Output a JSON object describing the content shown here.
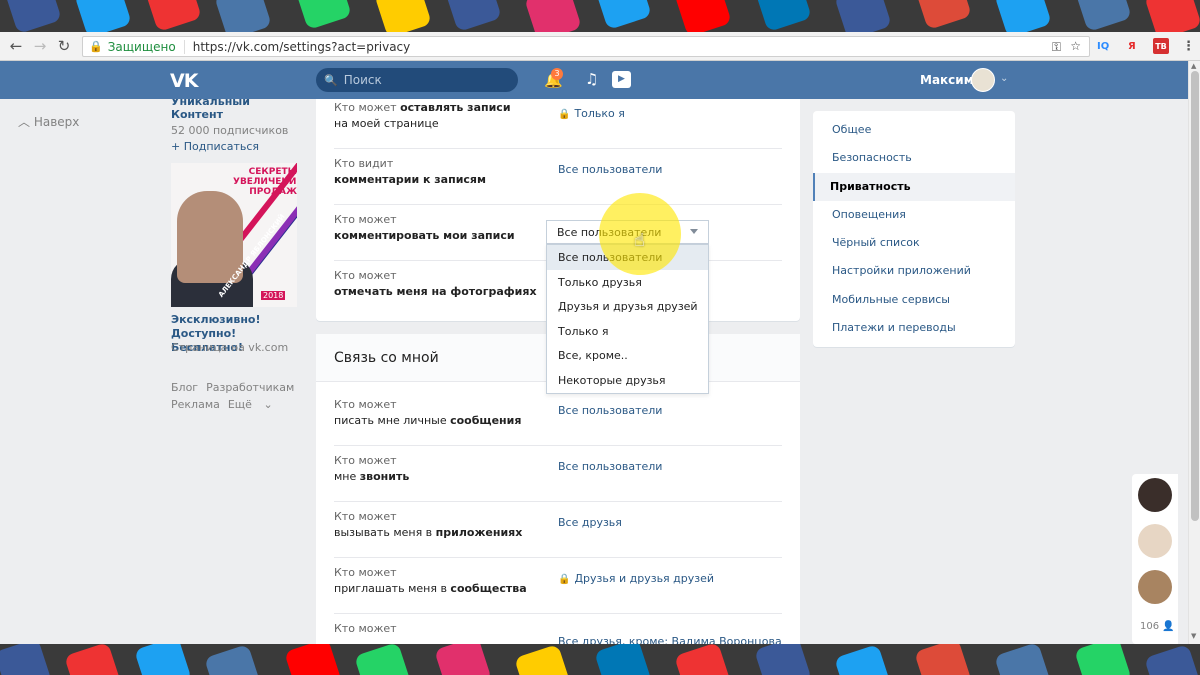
{
  "colors": {
    "vk_blue": "#4a76a8",
    "link": "#2a5885",
    "accent_bar": "#5181b8",
    "badge": "#ff7a3d",
    "secure_green": "#1e8e3e",
    "highlight": "#ffe600"
  },
  "browser": {
    "back_icon": "arrow-left-icon",
    "forward_icon": "arrow-right-icon",
    "reload_icon": "reload-icon",
    "secure_label": "Защищено",
    "url": "https://vk.com/settings?act=privacy",
    "key_icon": "key-icon",
    "star_icon": "star-icon",
    "extensions": [
      {
        "label": "IQ",
        "color": "#2d8cff"
      },
      {
        "label": "Я",
        "color": "#e62d2d"
      },
      {
        "label": "ТВ",
        "color": "#d63031"
      }
    ],
    "menu_icon": "kebab-menu-icon"
  },
  "vk_header": {
    "logo": "VK",
    "search_placeholder": "Поиск",
    "notifications_count": "3",
    "user_name": "Максим"
  },
  "left": {
    "up_link": "Наверх",
    "group_title": "Уникальный Контент",
    "group_subs": "52 000 подписчиков",
    "subscribe": "+ Подписаться",
    "ad_image_head": "СЕКРЕТЫ УВЕЛИЧЕНИЯ ПРОДАЖ",
    "ad_image_name": "АЛЕКСАНДР ЯБЛОНСКИЙ",
    "ad_image_year": "2018",
    "ad_title": "Эксклюзивно! Доступно! Бесплатно!",
    "ad_sub": "Страница на vk.com",
    "footer": {
      "blog": "Блог",
      "dev": "Разработчикам",
      "ads": "Реклама",
      "more": "Ещё"
    }
  },
  "card1": {
    "rows": [
      {
        "l1": "Кто может ",
        "b1": "оставлять записи",
        "l2": "на моей странице",
        "value": "Только я",
        "lock": true
      },
      {
        "l1": "Кто видит",
        "l2b": "комментарии к записям",
        "value": "Все пользователи"
      },
      {
        "l1": "Кто может",
        "l2b": "комментировать мои записи",
        "value": ""
      },
      {
        "l1": "Кто может",
        "l2b": "отмечать меня на фотографиях",
        "value": ""
      }
    ]
  },
  "dropdown": {
    "selected": "Все пользователи",
    "options": [
      "Все пользователи",
      "Только друзья",
      "Друзья и друзья друзей",
      "Только я",
      "Все, кроме..",
      "Некоторые друзья"
    ]
  },
  "card2": {
    "title": "Связь со мной",
    "rows": [
      {
        "l1": "Кто может",
        "l2": "писать мне личные ",
        "b2": "сообщения",
        "value": "Все пользователи"
      },
      {
        "l1": "Кто может",
        "l2": "мне ",
        "b2": "звонить",
        "value": "Все пользователи"
      },
      {
        "l1": "Кто может",
        "l2": "вызывать меня в ",
        "b2": "приложениях",
        "value": "Все друзья"
      },
      {
        "l1": "Кто может",
        "l2": "приглашать меня в ",
        "b2": "сообщества",
        "value": "Друзья и друзья друзей",
        "lock": true
      },
      {
        "l1": "Кто может",
        "l2": "",
        "b2": "",
        "value": "Все друзья, кроме: Вадима Воронцова"
      }
    ]
  },
  "settings_menu": [
    {
      "label": "Общее"
    },
    {
      "label": "Безопасность"
    },
    {
      "label": "Приватность",
      "active": true
    },
    {
      "label": "Оповещения"
    },
    {
      "label": "Чёрный список"
    },
    {
      "label": "Настройки приложений"
    },
    {
      "label": "Мобильные сервисы"
    },
    {
      "label": "Платежи и переводы"
    }
  ],
  "friends": {
    "count": "106"
  }
}
